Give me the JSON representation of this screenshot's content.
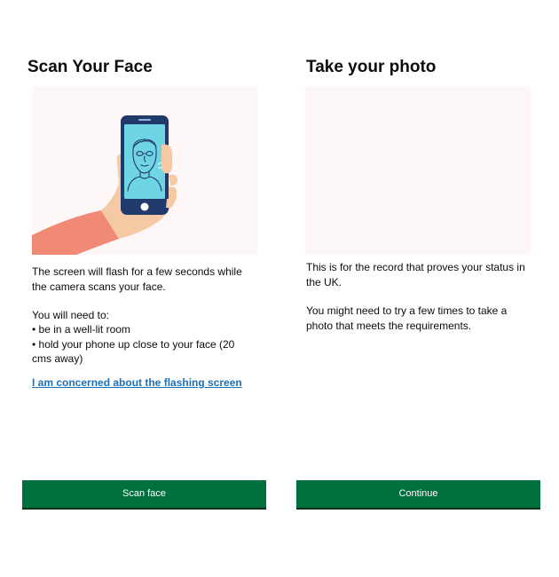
{
  "left": {
    "title": "Scan Your Face",
    "intro": "The screen will flash for a few seconds while the camera scans your face.",
    "need_heading": "You will need to:",
    "bullets": [
      "be in a well-lit room",
      "hold your phone up close to your face (20 cms away)"
    ],
    "link": "I am concerned about the flashing screen",
    "button": "Scan face"
  },
  "right": {
    "title": "Take your photo",
    "para1": "This is for the record that proves your status in the UK.",
    "para2": "You might need to try a few times to take a photo that meets the requirements.",
    "button": "Continue"
  },
  "colors": {
    "button_green": "#00703c",
    "link_blue": "#1d70b8",
    "image_background": "#fdf7f8",
    "phone_body": "#1f3a6b",
    "phone_screen": "#6fd4e4",
    "sleeve": "#f08a74",
    "skin": "#f5c9a3"
  },
  "icons": {
    "illustration": "hand-holding-phone-face-scan"
  }
}
